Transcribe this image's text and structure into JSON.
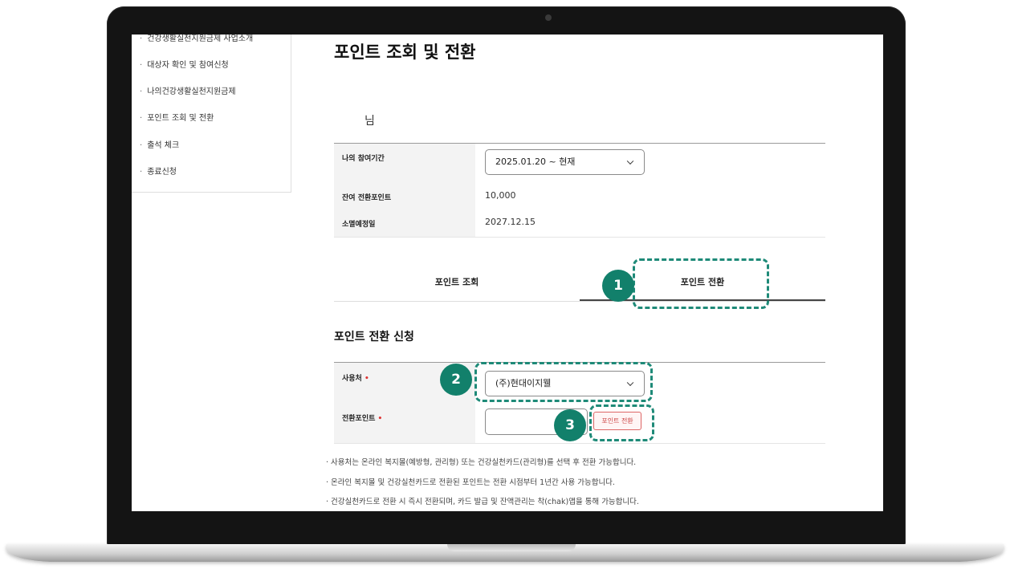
{
  "sidebar": {
    "items": [
      {
        "label": "건강생활실천지원금제 사업소개"
      },
      {
        "label": "대상자 확인 및 참여신청"
      },
      {
        "label": "나의건강생활실천지원금제"
      },
      {
        "label": "포인트 조회 및 전환"
      },
      {
        "label": "출석 체크"
      },
      {
        "label": "종료신청"
      }
    ]
  },
  "page": {
    "title": "포인트 조회 및 전환",
    "username": "님"
  },
  "info": {
    "period_label": "나의 참여기간",
    "period_value": "2025.01.20 ~ 현재",
    "balance_label": "잔여 전환포인트",
    "balance_value": "10,000",
    "expiry_label": "소멸예정일",
    "expiry_value": "2027.12.15"
  },
  "tabs": [
    {
      "label": "포인트 조회",
      "active": false
    },
    {
      "label": "포인트 전환",
      "active": true
    }
  ],
  "form": {
    "title": "포인트 전환 신청",
    "usage_label": "사용처",
    "usage_value": "(주)현대이지웰",
    "points_label": "전환포인트",
    "required_mark": "•",
    "convert_button": "포인트 전환"
  },
  "notes": [
    "· 사용처는 온라인 복지몰(예방형, 관리형) 또는 건강실천카드(관리형)를 선택 후 전환 가능합니다.",
    "· 온라인 복지몰 및 건강실천카드로 전환된 포인트는 전환 시점부터 1년간 사용 가능합니다.",
    "· 건강실천카드로 전환 시 즉시 전환되며, 카드 발급 및 잔액관리는 착(chak)앱을 통해 가능합니다."
  ],
  "callouts": [
    "1",
    "2",
    "3"
  ],
  "colors": {
    "callout": "#12806b",
    "required": "#d33333",
    "button_text": "#c44444"
  },
  "icons": [
    "chevron-down-icon",
    "camera-icon"
  ]
}
